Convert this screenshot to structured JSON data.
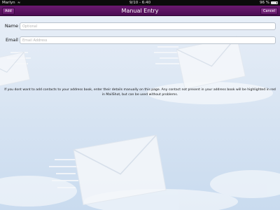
{
  "status_bar": {
    "carrier": "Marlyn",
    "time": "9/10 - 6:40",
    "battery": "96 %"
  },
  "nav_bar": {
    "left_button": "Add",
    "title": "Manual Entry",
    "right_button": "Cancel",
    "color": "#5a1260"
  },
  "form": {
    "name_label": "Name",
    "name_placeholder": "Optional",
    "name_value": "",
    "email_label": "Email",
    "email_placeholder": "Email Address",
    "email_value": ""
  },
  "info_text": "If you dont want to add contacts to your address book, enter their details manually on this page. Any contact not present in your address book will be highlighted in red in MailShot, but can be used without problems.",
  "icons": [
    "wifi-icon",
    "battery-icon",
    "envelope-watermark"
  ]
}
